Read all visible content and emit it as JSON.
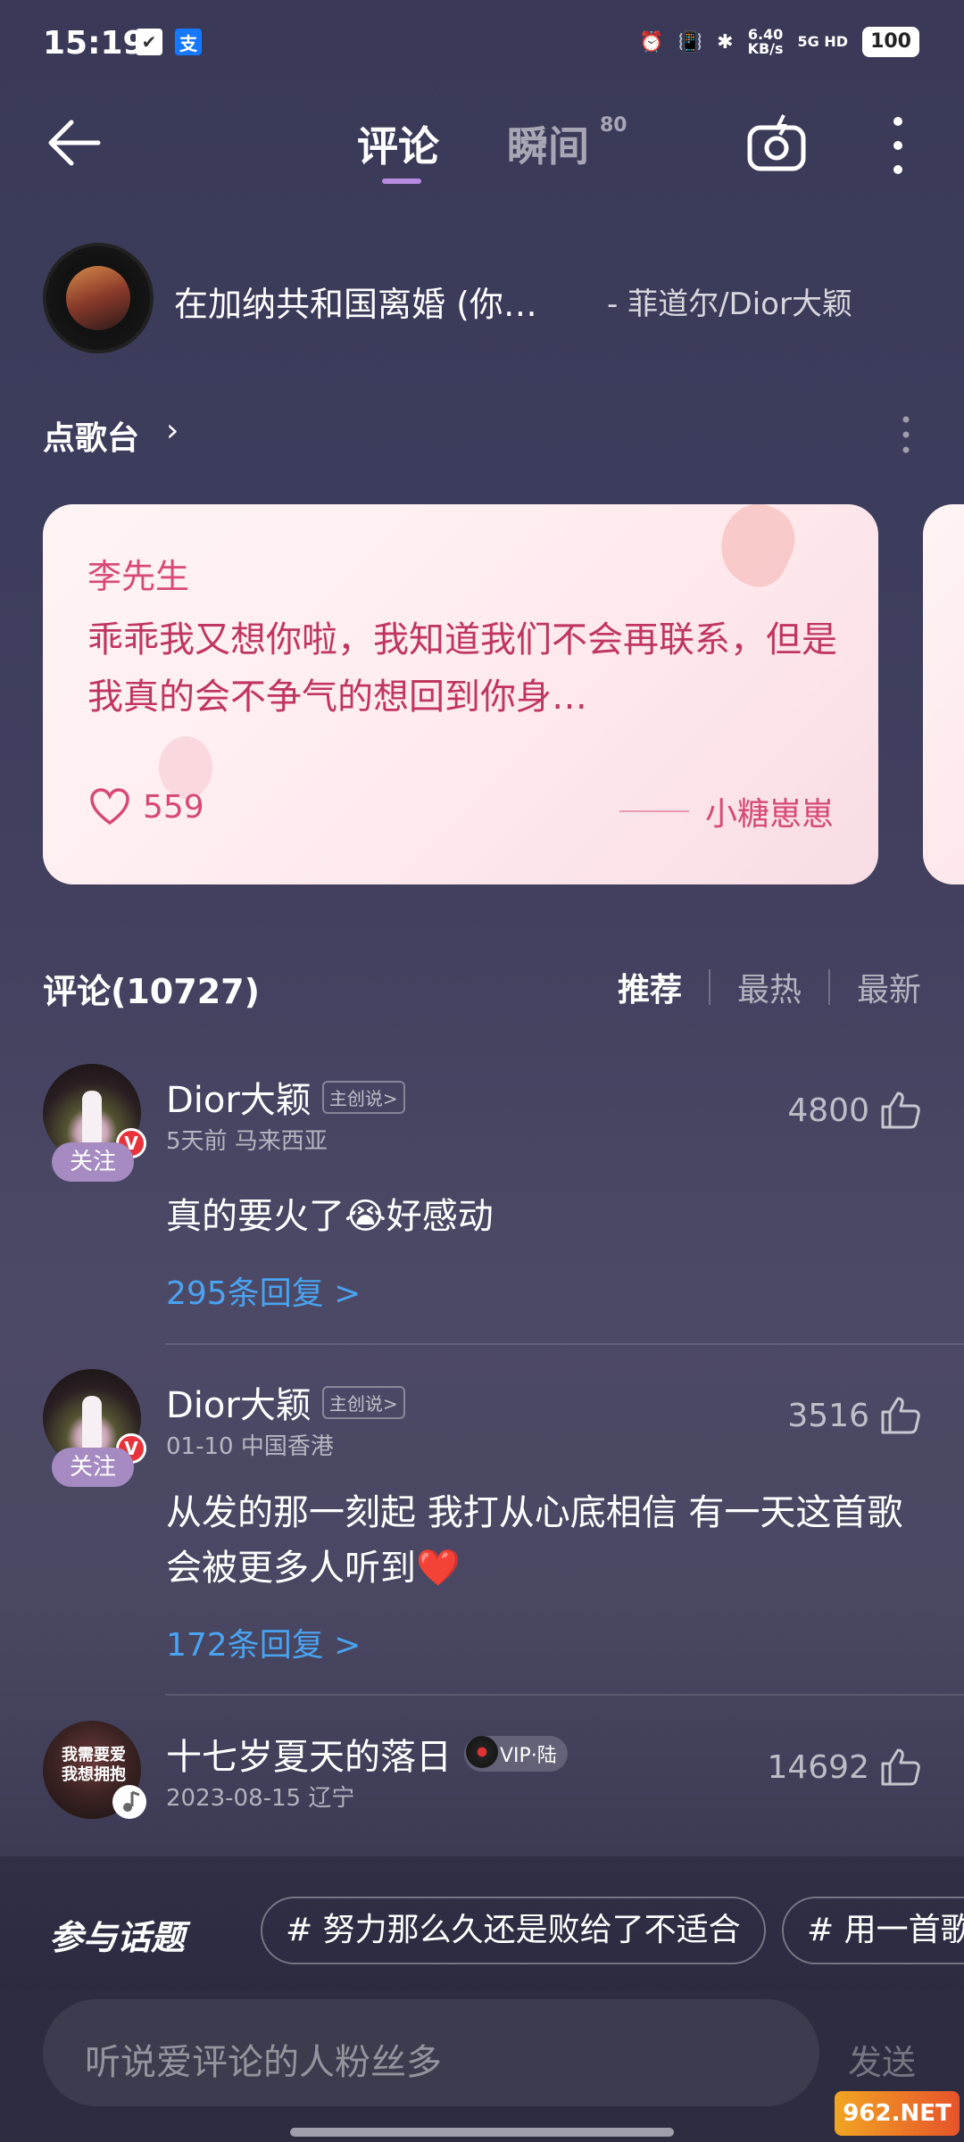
{
  "status_bar": {
    "time": "15:19",
    "net_speed_value": "6.40",
    "net_speed_unit": "KB/s",
    "signal": "5G HD",
    "battery": "100"
  },
  "header": {
    "tabs": [
      {
        "label": "评论",
        "active": true
      },
      {
        "label": "瞬间",
        "active": false,
        "sup": "80"
      }
    ]
  },
  "song": {
    "title": "在加纳共和国离婚 (你…",
    "artist": "- 菲道尔/Dior大颖"
  },
  "dedication": {
    "title": "点歌台",
    "card": {
      "to": "李先生",
      "message": "乖乖我又想你啦，我知道我们不会再联系，但是我真的会不争气的想回到你身…",
      "likes": "559",
      "from": "小糖崽崽"
    }
  },
  "comments": {
    "title": "评论(10727)",
    "sort_tabs": [
      {
        "label": "推荐",
        "active": true
      },
      {
        "label": "最热",
        "active": false
      },
      {
        "label": "最新",
        "active": false
      }
    ],
    "items": [
      {
        "name": "Dior大颖",
        "tag": "主创说>",
        "meta": "5天前 马来西亚",
        "likes": "4800",
        "follow": "关注",
        "badge": "V",
        "text": "真的要火了😭好感动",
        "replies": "295条回复 >"
      },
      {
        "name": "Dior大颖",
        "tag": "主创说>",
        "meta": "01-10 中国香港",
        "likes": "3516",
        "follow": "关注",
        "badge": "V",
        "text": "从发的那一刻起 我打从心底相信 有一天这首歌会被更多人听到❤️",
        "replies": "172条回复 >"
      },
      {
        "name": "十七岁夏天的落日",
        "vip": "VIP·陆",
        "meta": "2023-08-15 辽宁",
        "likes": "14692",
        "avatar_text": "我需要爱 我想拥抱"
      }
    ]
  },
  "topics": {
    "title": "参与话题",
    "chips": [
      "# 努力那么久还是败给了不适合",
      "# 用一首歌"
    ]
  },
  "input": {
    "placeholder": "听说爱评论的人粉丝多",
    "send": "发送"
  },
  "watermark": "962.NET",
  "colors": {
    "accent": "#b98be0",
    "reply_link": "#4aa3f0",
    "card_text": "#c0365e",
    "verified_badge": "#e8333a"
  }
}
